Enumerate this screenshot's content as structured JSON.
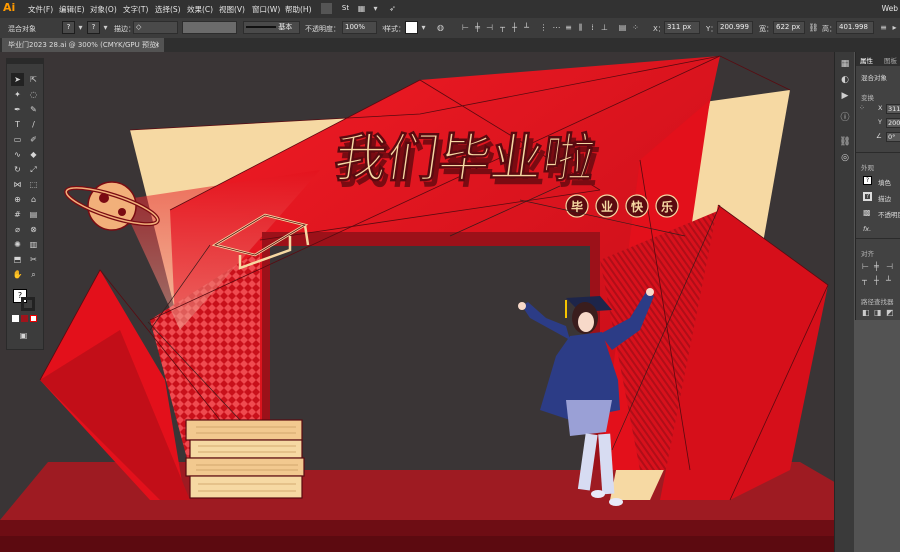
{
  "app": {
    "logo": "Ai",
    "workspace": "Web"
  },
  "menu": [
    "文件(F)",
    "编辑(E)",
    "对象(O)",
    "文字(T)",
    "选择(S)",
    "效果(C)",
    "视图(V)",
    "窗口(W)",
    "帮助(H)"
  ],
  "control_bar": {
    "selection": "混合对象",
    "stroke_label": "描边：",
    "stroke_style": "基本",
    "opacity_label": "不透明度：",
    "opacity_value": "100%",
    "style_label": "样式：",
    "x_label": "X：",
    "x_value": "311 px",
    "y_label": "Y：",
    "y_value": "200.999",
    "w_label": "宽：",
    "w_value": "622 px",
    "h_label": "高：",
    "h_value": "401.998"
  },
  "document_tab": {
    "title": "毕业门2023 28.ai @ 300% (CMYK/GPU 预览)",
    "close": "×"
  },
  "artwork": {
    "headline": "我们毕业啦",
    "badges": [
      "毕",
      "业",
      "快",
      "乐"
    ],
    "colors": {
      "red": "#e3101b",
      "dark_red": "#a4121c",
      "cream": "#f6d9a3",
      "gown": "#2c3c86",
      "floor": "#9e1b22"
    }
  },
  "properties_panel": {
    "tabs": [
      "属性",
      "图板"
    ],
    "object_type": "混合对象",
    "transform_label": "变换",
    "x_label": "X",
    "x_value": "311",
    "y_label": "Y",
    "y_value": "200",
    "rotation_label": "∠",
    "rotation_value": "0°",
    "appearance_label": "外观",
    "fill_label": "填色",
    "stroke_label": "描边",
    "opacity_label": "不透明度",
    "fx_label": "fx.",
    "align_label": "对齐",
    "pathfinder_label": "路径查找器"
  },
  "icons": [
    "selection-tool-icon",
    "direct-selection-icon",
    "pen-icon",
    "type-icon",
    "rectangle-icon",
    "brush-icon",
    "eraser-icon",
    "rotate-icon",
    "scale-icon",
    "width-icon",
    "shape-builder-icon",
    "perspective-icon",
    "mesh-icon",
    "gradient-icon",
    "eyedropper-icon",
    "blend-icon",
    "symbol-sprayer-icon",
    "graph-icon",
    "artboard-icon",
    "slice-icon",
    "hand-icon",
    "zoom-icon"
  ]
}
